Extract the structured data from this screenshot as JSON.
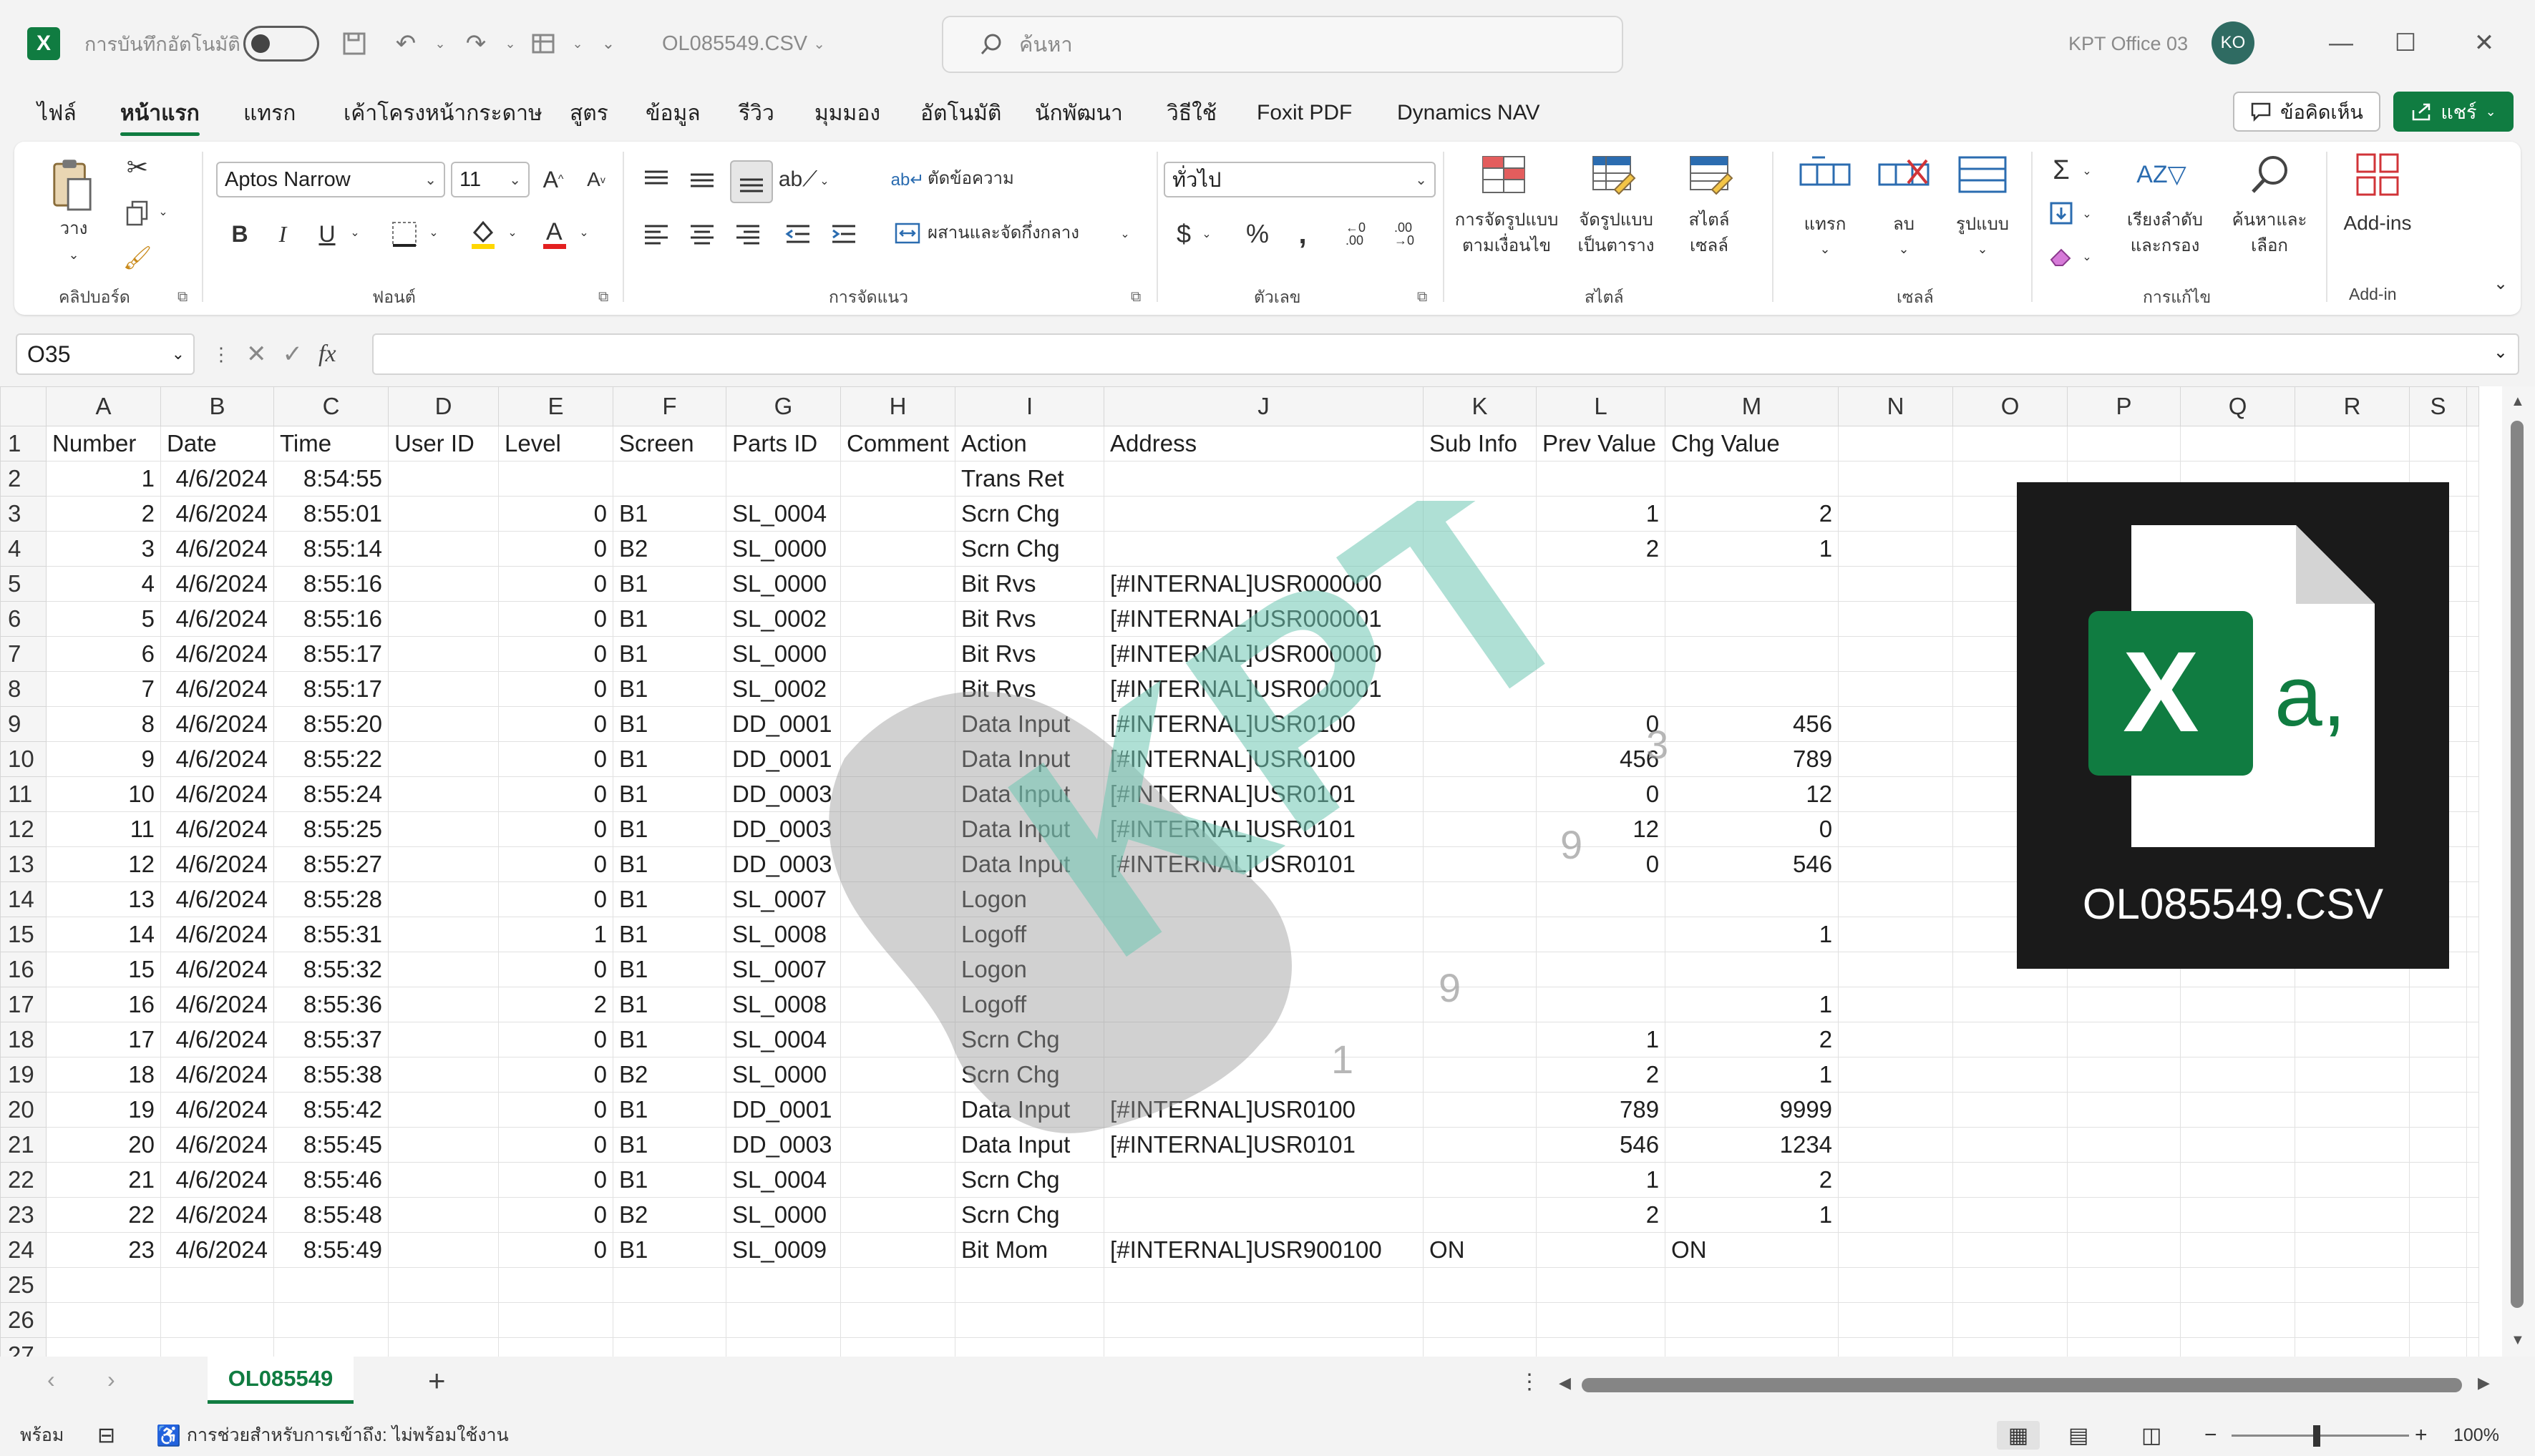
{
  "titlebar": {
    "app_icon_letter": "X",
    "autosave_label": "การบันทึกอัตโนมัติ",
    "file_name": "OL085549.CSV",
    "search_placeholder": "ค้นหา",
    "user_name": "KPT Office 03",
    "user_initials": "KO"
  },
  "menu": {
    "tabs": [
      "ไฟล์",
      "หน้าแรก",
      "แทรก",
      "เค้าโครงหน้ากระดาษ",
      "สูตร",
      "ข้อมูล",
      "รีวิว",
      "มุมมอง",
      "อัตโนมัติ",
      "นักพัฒนา",
      "วิธีใช้",
      "Foxit PDF",
      "Dynamics NAV"
    ],
    "active_tab": "หน้าแรก",
    "comments_label": "ข้อคิดเห็น",
    "share_label": "แชร์"
  },
  "ribbon": {
    "clipboard": {
      "paste_label": "วาง",
      "group_label": "คลิปบอร์ด"
    },
    "font": {
      "font_name": "Aptos Narrow",
      "font_size": "11",
      "group_label": "ฟอนต์"
    },
    "alignment": {
      "wrap_label": "ตัดข้อความ",
      "merge_label": "ผสานและจัดกึ่งกลาง",
      "group_label": "การจัดแนว"
    },
    "number": {
      "format_value": "ทั่วไป",
      "group_label": "ตัวเลข"
    },
    "styles": {
      "conditional_label_1": "การจัดรูปแบบ",
      "conditional_label_2": "ตามเงื่อนไข",
      "table_label_1": "จัดรูปแบบ",
      "table_label_2": "เป็นตาราง",
      "cell_styles_label_1": "สไตล์",
      "cell_styles_label_2": "เซลล์",
      "group_label": "สไตล์"
    },
    "cells": {
      "insert_label": "แทรก",
      "delete_label": "ลบ",
      "format_label": "รูปแบบ",
      "group_label": "เซลล์"
    },
    "editing": {
      "sort_label_1": "เรียงลำดับ",
      "sort_label_2": "และกรอง",
      "find_label_1": "ค้นหาและ",
      "find_label_2": "เลือก",
      "group_label": "การแก้ไข"
    },
    "addins": {
      "label": "Add-ins",
      "group_label": "Add-in"
    }
  },
  "formula_bar": {
    "name_box": "O35",
    "fx": "fx",
    "formula": ""
  },
  "sheet": {
    "column_letters": [
      "A",
      "B",
      "C",
      "D",
      "E",
      "F",
      "G",
      "H",
      "I",
      "J",
      "K",
      "L",
      "M",
      "N",
      "O",
      "P",
      "Q",
      "R",
      "S"
    ],
    "header_row": [
      "Number",
      "Date",
      "Time",
      "User ID",
      "Level",
      "Screen",
      "Parts ID",
      "Comment",
      "Action",
      "Address",
      "Sub Info",
      "Prev Value",
      "Chg Value"
    ],
    "rows": [
      [
        "1",
        "4/6/2024",
        "8:54:55",
        "",
        "",
        "",
        "",
        "",
        "Trans Ret",
        "",
        "",
        "",
        ""
      ],
      [
        "2",
        "4/6/2024",
        "8:55:01",
        "",
        "0",
        "B1",
        "SL_0004",
        "",
        "Scrn Chg",
        "",
        "",
        "1",
        "2"
      ],
      [
        "3",
        "4/6/2024",
        "8:55:14",
        "",
        "0",
        "B2",
        "SL_0000",
        "",
        "Scrn Chg",
        "",
        "",
        "2",
        "1"
      ],
      [
        "4",
        "4/6/2024",
        "8:55:16",
        "",
        "0",
        "B1",
        "SL_0000",
        "",
        "Bit Rvs",
        "[#INTERNAL]USR000000",
        "",
        "",
        ""
      ],
      [
        "5",
        "4/6/2024",
        "8:55:16",
        "",
        "0",
        "B1",
        "SL_0002",
        "",
        "Bit Rvs",
        "[#INTERNAL]USR000001",
        "",
        "",
        ""
      ],
      [
        "6",
        "4/6/2024",
        "8:55:17",
        "",
        "0",
        "B1",
        "SL_0000",
        "",
        "Bit Rvs",
        "[#INTERNAL]USR000000",
        "",
        "",
        ""
      ],
      [
        "7",
        "4/6/2024",
        "8:55:17",
        "",
        "0",
        "B1",
        "SL_0002",
        "",
        "Bit Rvs",
        "[#INTERNAL]USR000001",
        "",
        "",
        ""
      ],
      [
        "8",
        "4/6/2024",
        "8:55:20",
        "",
        "0",
        "B1",
        "DD_0001",
        "",
        "Data Input",
        "[#INTERNAL]USR0100",
        "",
        "0",
        "456"
      ],
      [
        "9",
        "4/6/2024",
        "8:55:22",
        "",
        "0",
        "B1",
        "DD_0001",
        "",
        "Data Input",
        "[#INTERNAL]USR0100",
        "",
        "456",
        "789"
      ],
      [
        "10",
        "4/6/2024",
        "8:55:24",
        "",
        "0",
        "B1",
        "DD_0003",
        "",
        "Data Input",
        "[#INTERNAL]USR0101",
        "",
        "0",
        "12"
      ],
      [
        "11",
        "4/6/2024",
        "8:55:25",
        "",
        "0",
        "B1",
        "DD_0003",
        "",
        "Data Input",
        "[#INTERNAL]USR0101",
        "",
        "12",
        "0"
      ],
      [
        "12",
        "4/6/2024",
        "8:55:27",
        "",
        "0",
        "B1",
        "DD_0003",
        "",
        "Data Input",
        "[#INTERNAL]USR0101",
        "",
        "0",
        "546"
      ],
      [
        "13",
        "4/6/2024",
        "8:55:28",
        "",
        "0",
        "B1",
        "SL_0007",
        "",
        "Logon",
        "",
        "",
        "",
        ""
      ],
      [
        "14",
        "4/6/2024",
        "8:55:31",
        "",
        "1",
        "B1",
        "SL_0008",
        "",
        "Logoff",
        "",
        "",
        "",
        "1"
      ],
      [
        "15",
        "4/6/2024",
        "8:55:32",
        "",
        "0",
        "B1",
        "SL_0007",
        "",
        "Logon",
        "",
        "",
        "",
        ""
      ],
      [
        "16",
        "4/6/2024",
        "8:55:36",
        "",
        "2",
        "B1",
        "SL_0008",
        "",
        "Logoff",
        "",
        "",
        "",
        "1"
      ],
      [
        "17",
        "4/6/2024",
        "8:55:37",
        "",
        "0",
        "B1",
        "SL_0004",
        "",
        "Scrn Chg",
        "",
        "",
        "1",
        "2"
      ],
      [
        "18",
        "4/6/2024",
        "8:55:38",
        "",
        "0",
        "B2",
        "SL_0000",
        "",
        "Scrn Chg",
        "",
        "",
        "2",
        "1"
      ],
      [
        "19",
        "4/6/2024",
        "8:55:42",
        "",
        "0",
        "B1",
        "DD_0001",
        "",
        "Data Input",
        "[#INTERNAL]USR0100",
        "",
        "789",
        "9999"
      ],
      [
        "20",
        "4/6/2024",
        "8:55:45",
        "",
        "0",
        "B1",
        "DD_0003",
        "",
        "Data Input",
        "[#INTERNAL]USR0101",
        "",
        "546",
        "1234"
      ],
      [
        "21",
        "4/6/2024",
        "8:55:46",
        "",
        "0",
        "B1",
        "SL_0004",
        "",
        "Scrn Chg",
        "",
        "",
        "1",
        "2"
      ],
      [
        "22",
        "4/6/2024",
        "8:55:48",
        "",
        "0",
        "B2",
        "SL_0000",
        "",
        "Scrn Chg",
        "",
        "",
        "2",
        "1"
      ],
      [
        "23",
        "4/6/2024",
        "8:55:49",
        "",
        "0",
        "B1",
        "SL_0009",
        "",
        "Bit Mom",
        "[#INTERNAL]USR900100",
        "ON",
        "",
        "ON"
      ]
    ],
    "empty_row_numbers": [
      "25",
      "26"
    ],
    "overlay_file_label": "OL085549.CSV",
    "overlay_icon_letters": "X",
    "overlay_icon_suffix": "a,",
    "watermark_text": "KPT",
    "watermark_digits": [
      "1",
      "9",
      "9",
      "3"
    ]
  },
  "tabs": {
    "sheet_name": "OL085549",
    "add_sheet": "+"
  },
  "status": {
    "ready": "พร้อม",
    "accessibility": "การช่วยสำหรับการเข้าถึง: ไม่พร้อมใช้งาน",
    "zoom": "100%"
  },
  "colors": {
    "accent": "#107c41",
    "watermark_green": "#6fc7b3",
    "watermark_grey": "#9a9a9a"
  }
}
